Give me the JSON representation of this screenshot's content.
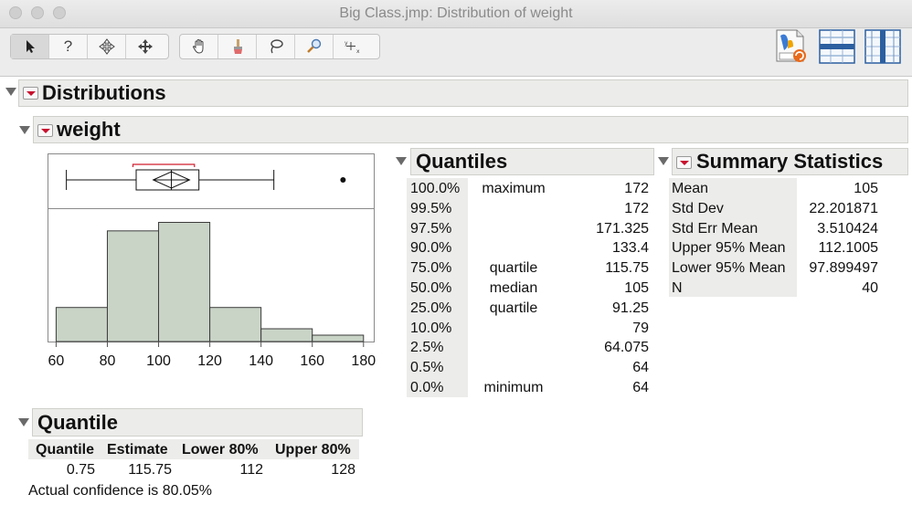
{
  "window": {
    "title": "Big Class.jmp: Distribution of weight"
  },
  "toolbar": {
    "tools": [
      "arrow-tool-icon",
      "help-tool-icon",
      "scroller-tool-icon",
      "grabber-tool-icon",
      "hand-tool-icon",
      "brush-tool-icon",
      "lasso-tool-icon",
      "magnifier-tool-icon",
      "crosshair-tool-icon"
    ]
  },
  "report": {
    "distributions_label": "Distributions",
    "variable_label": "weight",
    "quantiles": {
      "title": "Quantiles",
      "rows": [
        {
          "pct": "100.0%",
          "label": "maximum",
          "value": "172"
        },
        {
          "pct": "99.5%",
          "label": "",
          "value": "172"
        },
        {
          "pct": "97.5%",
          "label": "",
          "value": "171.325"
        },
        {
          "pct": "90.0%",
          "label": "",
          "value": "133.4"
        },
        {
          "pct": "75.0%",
          "label": "quartile",
          "value": "115.75"
        },
        {
          "pct": "50.0%",
          "label": "median",
          "value": "105"
        },
        {
          "pct": "25.0%",
          "label": "quartile",
          "value": "91.25"
        },
        {
          "pct": "10.0%",
          "label": "",
          "value": "79"
        },
        {
          "pct": "2.5%",
          "label": "",
          "value": "64.075"
        },
        {
          "pct": "0.5%",
          "label": "",
          "value": "64"
        },
        {
          "pct": "0.0%",
          "label": "minimum",
          "value": "64"
        }
      ]
    },
    "summary": {
      "title": "Summary Statistics",
      "rows": [
        {
          "label": "Mean",
          "value": "105"
        },
        {
          "label": "Std Dev",
          "value": "22.201871"
        },
        {
          "label": "Std Err Mean",
          "value": "3.510424"
        },
        {
          "label": "Upper 95% Mean",
          "value": "112.1005"
        },
        {
          "label": "Lower 95% Mean",
          "value": "97.899497"
        },
        {
          "label": "N",
          "value": "40"
        }
      ]
    },
    "quantile_ci": {
      "title": "Quantile",
      "headers": [
        "Quantile",
        "Estimate",
        "Lower 80%",
        "Upper 80%"
      ],
      "row": [
        "0.75",
        "115.75",
        "112",
        "128"
      ],
      "note": "Actual confidence is 80.05%"
    }
  },
  "chart_data": {
    "type": "bar",
    "x_ticks": [
      60,
      80,
      100,
      120,
      140,
      160,
      180
    ],
    "xlim": [
      57,
      184
    ],
    "bins": [
      {
        "from": 60,
        "to": 80,
        "value": 0.16
      },
      {
        "from": 80,
        "to": 100,
        "value": 0.52
      },
      {
        "from": 100,
        "to": 120,
        "value": 0.56
      },
      {
        "from": 120,
        "to": 140,
        "value": 0.16
      },
      {
        "from": 140,
        "to": 160,
        "value": 0.06
      },
      {
        "from": 160,
        "to": 180,
        "value": 0.03
      }
    ],
    "boxplot": {
      "whisker_low": 64,
      "q1": 91.25,
      "median": 105,
      "q3": 115.75,
      "whisker_high": 145,
      "mean": 105,
      "mean_ci": [
        97.9,
        112.1
      ],
      "shortest_half": [
        90,
        114
      ],
      "outliers": [
        172
      ]
    },
    "colors": {
      "bar_fill": "#c9d4c7",
      "bar_stroke": "#3c3c3c",
      "accent": "#d11f2f"
    }
  }
}
